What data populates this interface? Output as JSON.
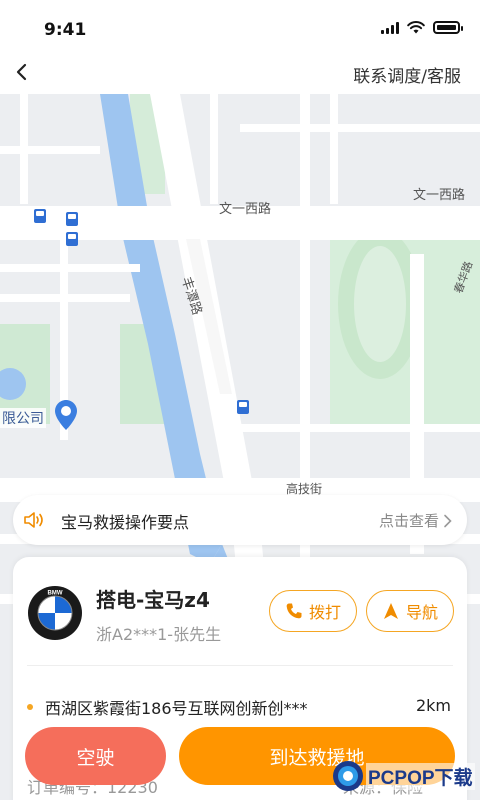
{
  "status_bar": {
    "time": "9:41",
    "icons": [
      "signal-icon",
      "wifi-icon",
      "battery-icon"
    ]
  },
  "nav": {
    "back_icon": "chevron-left-icon",
    "contact_label": "联系调度/客服"
  },
  "map": {
    "road_labels": [
      "文一西路",
      "文一西路",
      "丰潭路",
      "高技街",
      "春华路"
    ],
    "poi_label": "限公司",
    "icons": [
      "bus-stop-icon",
      "location-pin-icon"
    ],
    "colors": {
      "water": "#9ec5f0",
      "green": "#cfe9d3",
      "road": "#ffffff",
      "block": "#eceef1"
    }
  },
  "tip_bar": {
    "icon": "speaker-icon",
    "text": "宝马救援操作要点",
    "link": "点击查看"
  },
  "order_card": {
    "logo": "bmw-logo",
    "title": "搭电-宝马z4",
    "plate": "浙A2***1-张先生",
    "call_label": "拨打",
    "nav_label": "导航",
    "address": "西湖区紫霞街186号互联网创新创***",
    "distance": "2km",
    "order_no": "订单编号：12230",
    "source": "来源：保险"
  },
  "actions": {
    "empty_label": "空驶",
    "arrive_label": "到达救援地"
  },
  "watermark": {
    "text": "PCPOP下载"
  },
  "colors": {
    "accent": "#ff9500",
    "accent_outline": "#f5a623",
    "danger": "#f56e5b"
  }
}
